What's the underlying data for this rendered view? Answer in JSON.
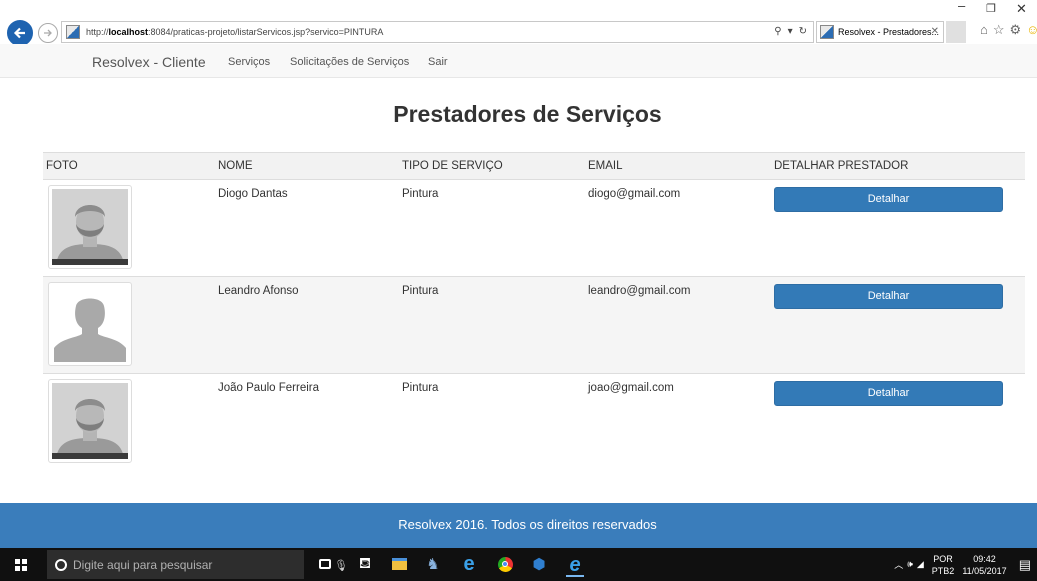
{
  "browser": {
    "url_prefix": "http://",
    "url_host": "localhost",
    "url_rest": ":8084/praticas-projeto/listarServicos.jsp?servico=PINTURA",
    "tab_title": "Resolvex - Prestadores..."
  },
  "navbar": {
    "brand": "Resolvex - Cliente",
    "links": [
      "Serviços",
      "Solicitações de Serviços",
      "Sair"
    ]
  },
  "page": {
    "title": "Prestadores de Serviços"
  },
  "table": {
    "headers": [
      "FOTO",
      "NOME",
      "TIPO DE SERVIÇO",
      "EMAIL",
      "DETALHAR PRESTADOR"
    ],
    "rows": [
      {
        "nome": "Diogo Dantas",
        "tipo": "Pintura",
        "email": "diogo@gmail.com",
        "action": "Detalhar",
        "photo": "bearded-man-placeholder"
      },
      {
        "nome": "Leandro Afonso",
        "tipo": "Pintura",
        "email": "leandro@gmail.com",
        "action": "Detalhar",
        "photo": "silhouette-placeholder"
      },
      {
        "nome": "João Paulo Ferreira",
        "tipo": "Pintura",
        "email": "joao@gmail.com",
        "action": "Detalhar",
        "photo": "bearded-man-placeholder"
      }
    ]
  },
  "footer": {
    "text": "Resolvex 2016. Todos os direitos reservados"
  },
  "taskbar": {
    "search_placeholder": "Digite aqui para pesquisar",
    "lang_top": "POR",
    "lang_bottom": "PTB2",
    "time": "09:42",
    "date": "11/05/2017"
  },
  "colors": {
    "primary": "#337ab7",
    "footer": "#3a7dbb",
    "navbar_bg": "#f8f8f8",
    "taskbar_bg": "#101010"
  }
}
